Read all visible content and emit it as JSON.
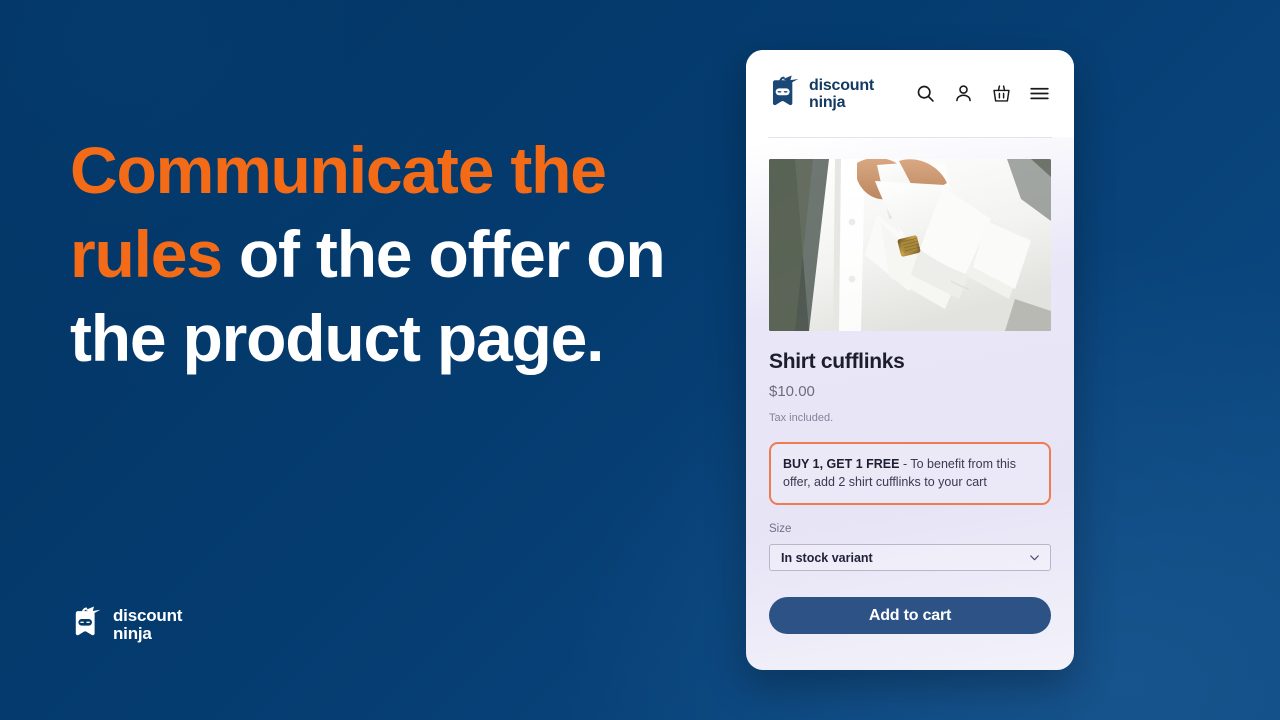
{
  "colors": {
    "background_navy": "#043a6b",
    "accent_orange": "#f36b16",
    "offer_border": "#ef7b52",
    "button_blue": "#2d5286",
    "card_lavender": "#e8e6f7",
    "brand_navy": "#143a63"
  },
  "headline": {
    "accent_text": "Communicate the rules",
    "rest_text": " of the offer on the product page."
  },
  "footer_logo": {
    "line1": "discount",
    "line2": "ninja",
    "icon": "discount-ninja-tag-icon"
  },
  "phone": {
    "header": {
      "brand": {
        "line1": "discount",
        "line2": "ninja",
        "icon": "discount-ninja-tag-icon"
      },
      "icons": [
        {
          "name": "search-icon"
        },
        {
          "name": "account-icon"
        },
        {
          "name": "cart-icon"
        },
        {
          "name": "menu-icon"
        }
      ]
    },
    "product": {
      "image_alt": "white dress shirt cuff with gold cufflink",
      "title": "Shirt cufflinks",
      "price": "$10.00",
      "tax_note": "Tax included."
    },
    "offer": {
      "headline": "BUY 1, GET 1 FREE",
      "separator": " - ",
      "body": "To benefit from this offer, add 2 shirt cufflinks to your cart"
    },
    "variant": {
      "label": "Size",
      "selected": "In stock variant",
      "chevron": "chevron-down-icon"
    },
    "cta": {
      "label": "Add to cart"
    }
  }
}
